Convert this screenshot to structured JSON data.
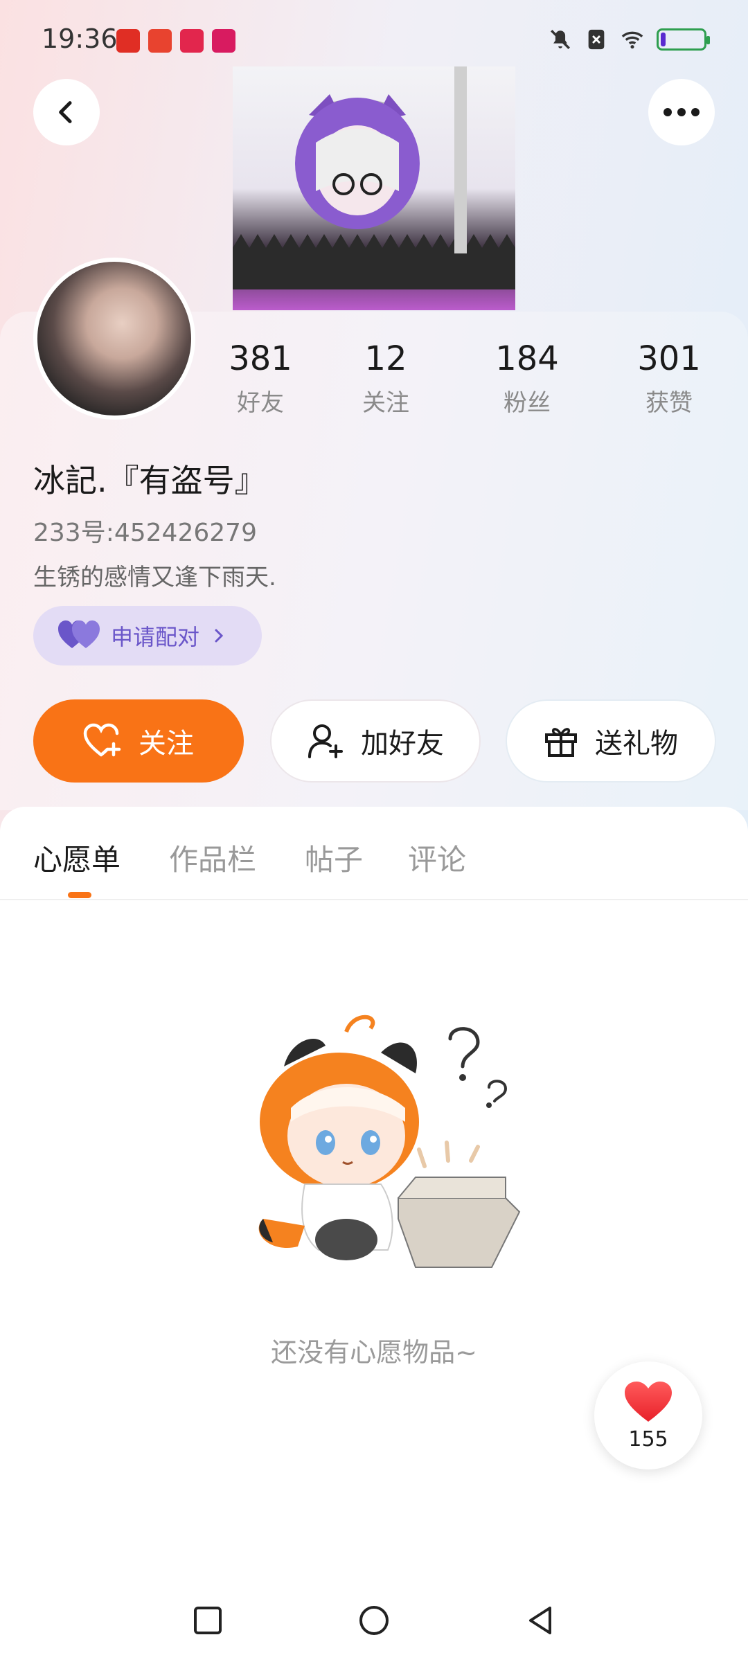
{
  "status_bar": {
    "time": "19:36",
    "app_icons": [
      {
        "name": "pinduoduo-app-icon",
        "color": "#e02e24"
      },
      {
        "name": "taobao-app-icon",
        "color": "#e8432f"
      },
      {
        "name": "deals-app-icon",
        "color": "#e2264d"
      },
      {
        "name": "shopping-app-icon",
        "color": "#d81b60"
      }
    ],
    "battery_level": 0.12
  },
  "header": {
    "back_icon": "chevron-left-icon",
    "more_icon": "more-dots-icon"
  },
  "profile": {
    "stats": [
      {
        "value": "381",
        "label": "好友"
      },
      {
        "value": "12",
        "label": "关注"
      },
      {
        "value": "184",
        "label": "粉丝"
      },
      {
        "value": "301",
        "label": "获赞"
      }
    ],
    "username": "冰記.『有盗号』",
    "uid": "233号:452426279",
    "bio": "生锈的感情又逢下雨天.",
    "pair_label": "申请配对"
  },
  "actions": {
    "follow": "关注",
    "add_friend": "加好友",
    "send_gift": "送礼物"
  },
  "tabs": [
    {
      "label": "心愿单",
      "active": true
    },
    {
      "label": "作品栏",
      "active": false
    },
    {
      "label": "帖子",
      "active": false
    },
    {
      "label": "评论",
      "active": false
    }
  ],
  "empty_state": {
    "text": "还没有心愿物品~"
  },
  "like_fab": {
    "count": "155"
  },
  "colors": {
    "accent": "#f97316",
    "pair": "#6a56c9",
    "heart": "#f0343e"
  }
}
